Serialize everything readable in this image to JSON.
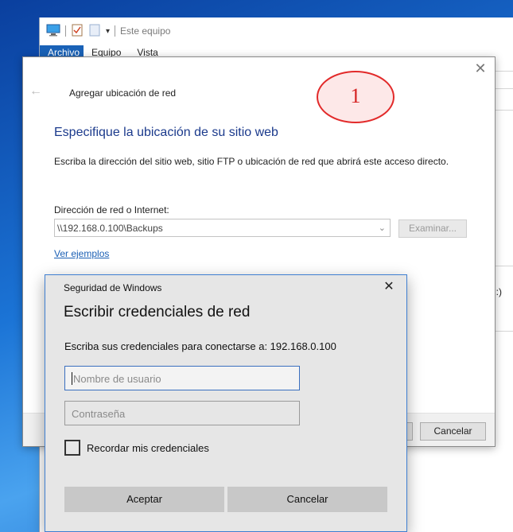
{
  "explorer": {
    "title": "Este equipo",
    "tabs": [
      "Archivo",
      "Equipo",
      "Vista"
    ],
    "side_text": ":)"
  },
  "wizard": {
    "title": "Agregar ubicación de red",
    "heading": "Especifique la ubicación de su sitio web",
    "description": "Escriba la dirección del sitio web, sitio FTP o ubicación de red que abrirá este acceso directo.",
    "address_label": "Dirección de red o Internet:",
    "address_value": "\\\\192.168.0.100\\Backups",
    "browse_label": "Examinar...",
    "examples_link": "Ver ejemplos",
    "cancel_label": "Cancelar"
  },
  "annotation": {
    "step_number": "1",
    "color": "#e22a2a"
  },
  "credentials": {
    "window_title": "Seguridad de Windows",
    "heading": "Escribir credenciales de red",
    "prompt": "Escriba sus credenciales para conectarse a: 192.168.0.100",
    "username_placeholder": "Nombre de usuario",
    "password_placeholder": "Contraseña",
    "remember_label": "Recordar mis credenciales",
    "ok_label": "Aceptar",
    "cancel_label": "Cancelar"
  },
  "icons": {
    "close": "close-icon",
    "back": "back-arrow-icon",
    "chevron": "chevron-down-icon",
    "computer": "computer-icon"
  },
  "colors": {
    "accent": "#1a62b7",
    "heading_blue": "#1b3a8c",
    "link": "#1a5fb4"
  }
}
